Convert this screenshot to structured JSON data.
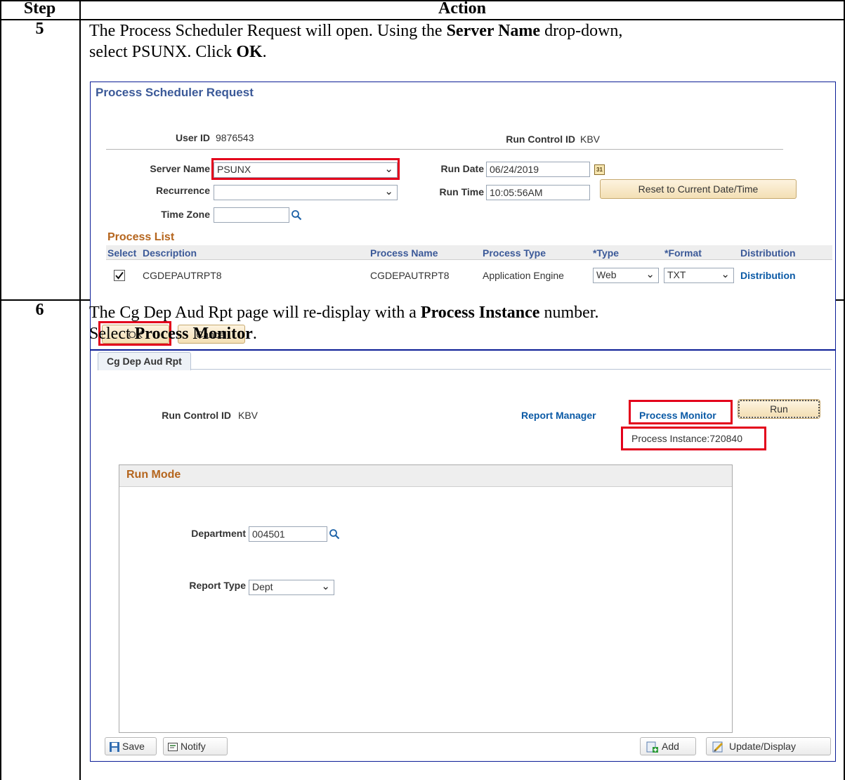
{
  "table": {
    "header_step": "Step",
    "header_action": "Action"
  },
  "step5": {
    "number": "5",
    "line1_pre": "The Process Scheduler Request will open.  Using the ",
    "line1_bold": "Server Name",
    "line1_post": " drop-down,",
    "line2_pre": "select PSUNX.  Click ",
    "line2_bold": "OK",
    "line2_post": "."
  },
  "psr": {
    "title": "Process Scheduler Request",
    "user_id_label": "User ID",
    "user_id_value": "9876543",
    "run_control_label": "Run Control ID",
    "run_control_value": "KBV",
    "server_name_label": "Server Name",
    "server_name_value": "PSUNX",
    "run_date_label": "Run Date",
    "run_date_value": "06/24/2019",
    "recurrence_label": "Recurrence",
    "recurrence_value": "",
    "run_time_label": "Run Time",
    "run_time_value": "10:05:56AM",
    "reset_button": "Reset to Current Date/Time",
    "time_zone_label": "Time Zone",
    "time_zone_value": "",
    "process_list_title": "Process List",
    "columns": [
      "Select",
      "Description",
      "Process Name",
      "Process Type",
      "*Type",
      "*Format",
      "Distribution"
    ],
    "row": {
      "checked": true,
      "description": "CGDEPAUTRPT8",
      "process_name": "CGDEPAUTRPT8",
      "process_type": "Application Engine",
      "type": "Web",
      "format": "TXT",
      "distribution": "Distribution"
    },
    "ok_button": "OK",
    "cancel_button": "Cancel"
  },
  "step6": {
    "number": "6",
    "line1_pre": "The Cg Dep Aud Rpt page will re-display with a ",
    "line1_bold": "Process Instance",
    "line1_post": " number.",
    "line2_pre": "Select ",
    "line2_bold": "Process Monitor",
    "line2_post": "."
  },
  "cg": {
    "tab": "Cg Dep Aud Rpt",
    "run_control_label": "Run Control ID",
    "run_control_value": "KBV",
    "report_manager": "Report Manager",
    "process_monitor": "Process Monitor",
    "run_button": "Run",
    "process_instance": "Process Instance:720840",
    "run_mode_title": "Run Mode",
    "department_label": "Department",
    "department_value": "004501",
    "report_type_label": "Report Type",
    "report_type_value": "Dept",
    "save_button": "Save",
    "notify_button": "Notify",
    "add_button": "Add",
    "update_button": "Update/Display"
  },
  "colors": {
    "highlight": "#e3001b",
    "link": "#0b5aa6",
    "title": "#3b5998"
  }
}
